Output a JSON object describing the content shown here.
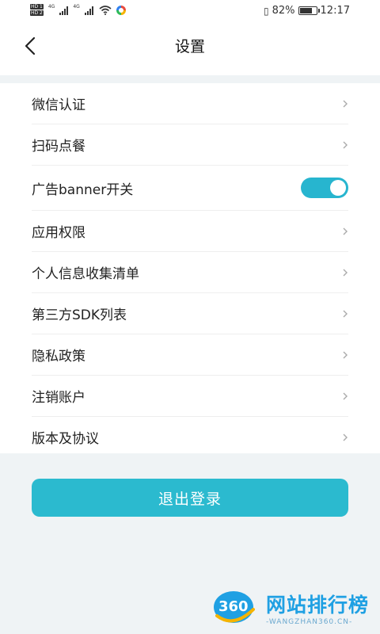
{
  "status_bar": {
    "hd_top": "HD 1",
    "hd_bottom": "HD 2",
    "sig1_tag": "4G",
    "sig2_tag": "4G",
    "battery_percent": "82%",
    "battery_level": 0.82,
    "time": "12:17",
    "icons": [
      "hd-icon",
      "signal-icon",
      "wifi-icon",
      "app-notification-icon",
      "vibrate-icon",
      "battery-icon"
    ]
  },
  "header": {
    "title": "设置",
    "back_icon": "chevron-left-icon"
  },
  "settings": {
    "items": [
      {
        "label": "微信认证",
        "type": "link"
      },
      {
        "label": "扫码点餐",
        "type": "link"
      },
      {
        "label": "广告banner开关",
        "type": "toggle",
        "on": true
      },
      {
        "label": "应用权限",
        "type": "link"
      },
      {
        "label": "个人信息收集清单",
        "type": "link"
      },
      {
        "label": "第三方SDK列表",
        "type": "link"
      },
      {
        "label": "隐私政策",
        "type": "link"
      },
      {
        "label": "注销账户",
        "type": "link"
      },
      {
        "label": "版本及协议",
        "type": "link"
      }
    ]
  },
  "logout_label": "退出登录",
  "watermark": {
    "logo_text": "360",
    "name": "网站排行榜",
    "url": "-WANGZHAN360.CN-"
  },
  "colors": {
    "accent": "#2bbacf",
    "toggle_on": "#27b5cf",
    "page_bg": "#eff3f5",
    "watermark": "#1fa0e3"
  }
}
